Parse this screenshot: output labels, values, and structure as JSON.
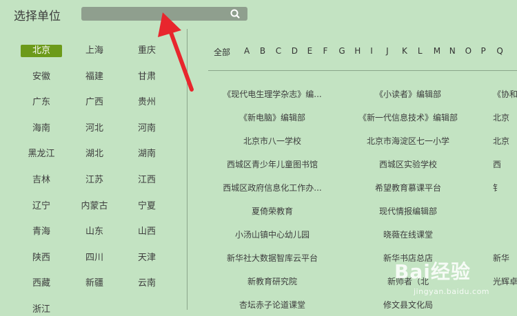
{
  "page": {
    "title": "选择单位"
  },
  "search": {
    "placeholder": ""
  },
  "provinces": [
    "北京",
    "上海",
    "重庆",
    "安徽",
    "福建",
    "甘肃",
    "广东",
    "广西",
    "贵州",
    "海南",
    "河北",
    "河南",
    "黑龙江",
    "湖北",
    "湖南",
    "吉林",
    "江苏",
    "江西",
    "辽宁",
    "内蒙古",
    "宁夏",
    "青海",
    "山东",
    "山西",
    "陕西",
    "四川",
    "天津",
    "西藏",
    "新疆",
    "云南",
    "浙江"
  ],
  "selected_province": "北京",
  "letters": [
    "全部",
    "A",
    "B",
    "C",
    "D",
    "E",
    "F",
    "G",
    "H",
    "I",
    "J",
    "K",
    "L",
    "M",
    "N",
    "O",
    "P",
    "Q"
  ],
  "units": [
    [
      "《现代电生理学杂志》编...",
      "《小读者》编辑部",
      "《协和"
    ],
    [
      "《新电脑》编辑部",
      "《新一代信息技术》编辑部",
      "北京"
    ],
    [
      "北京市八一学校",
      "北京市海淀区七一小学",
      "北京"
    ],
    [
      "西城区青少年儿童图书馆",
      "西城区实验学校",
      "西"
    ],
    [
      "西城区政府信息化工作办...",
      "希望教育慕课平台",
      "钅"
    ],
    [
      "夏倚荣教育",
      "现代情报编辑部",
      ""
    ],
    [
      "小汤山镇中心幼儿园",
      "晓薇在线课堂",
      ""
    ],
    [
      "新华社大数据智库云平台",
      "新华书店总店",
      "新华"
    ],
    [
      "新教育研究院",
      "新师者（北",
      "光辉卓越"
    ],
    [
      "杏坛赤子论道课堂",
      "修文县文化局",
      ""
    ]
  ],
  "watermark": {
    "main": "Bai经验",
    "sub": "jingyan.baidu.com"
  },
  "colors": {
    "background": "#c3e3c2",
    "selected": "#6c9a1a",
    "arrow": "#e8262d",
    "search": "#8f9f8e"
  }
}
